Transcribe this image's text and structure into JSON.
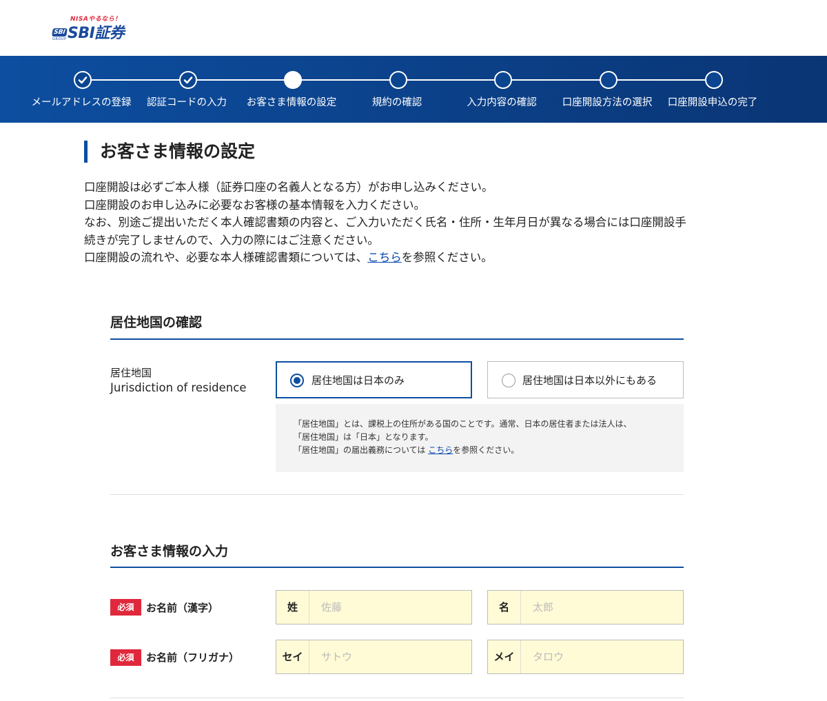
{
  "header": {
    "logo_tagline": "NISAやるなら！",
    "logo_group_mark": "SBI",
    "logo_group_text": "GROUP",
    "logo_text": "SBI証券"
  },
  "progress": {
    "steps": [
      {
        "label": "メールアドレスの登録",
        "state": "done"
      },
      {
        "label": "認証コードの入力",
        "state": "done"
      },
      {
        "label": "お客さま情報の設定",
        "state": "current"
      },
      {
        "label": "規約の確認",
        "state": "pending"
      },
      {
        "label": "入力内容の確認",
        "state": "pending"
      },
      {
        "label": "口座開設方法の選択",
        "state": "pending"
      },
      {
        "label": "口座開設申込の完了",
        "state": "pending"
      }
    ]
  },
  "page": {
    "title": "お客さま情報の設定",
    "intro": {
      "line1": "口座開設は必ずご本人様（証券口座の名義人となる方）がお申し込みください。",
      "line2": "口座開設のお申し込みに必要なお客様の基本情報を入力ください。",
      "line3": "なお、別途ご提出いただく本人確認書類の内容と、ご入力いただく氏名・住所・生年月日が異なる場合には口座開設手",
      "line4": "続きが完了しませんので、入力の際にはご注意ください。",
      "line5_before": "口座開設の流れや、必要な本人様確認書類については、",
      "line5_link": "こちら",
      "line5_after": "を参照ください。"
    }
  },
  "residence": {
    "heading": "居住地国の確認",
    "label_ja": "居住地国",
    "label_en": "Jurisdiction of residence",
    "options": [
      {
        "label": "居住地国は日本のみ",
        "selected": true
      },
      {
        "label": "居住地国は日本以外にもある",
        "selected": false
      }
    ],
    "note": {
      "line1": "「居住地国」とは、課税上の住所がある国のことです。通常、日本の居住者または法人は、",
      "line2": "「居住地国」は「日本」となります。",
      "line3_before": "「居住地国」の届出義務については ",
      "line3_link": "こちら",
      "line3_after": "を参照ください。"
    }
  },
  "customer": {
    "heading": "お客さま情報の入力",
    "required_badge": "必須",
    "name_kanji": {
      "label": "お名前（漢字）",
      "last_prefix": "姓",
      "last_placeholder": "佐藤",
      "first_prefix": "名",
      "first_placeholder": "太郎"
    },
    "name_kana": {
      "label": "お名前（フリガナ）",
      "last_prefix": "セイ",
      "last_placeholder": "サトウ",
      "first_prefix": "メイ",
      "first_placeholder": "タロウ"
    }
  },
  "colors": {
    "brand_blue": "#0d4ea0",
    "required_red": "#e0283c",
    "input_bg": "#fffbd6"
  }
}
